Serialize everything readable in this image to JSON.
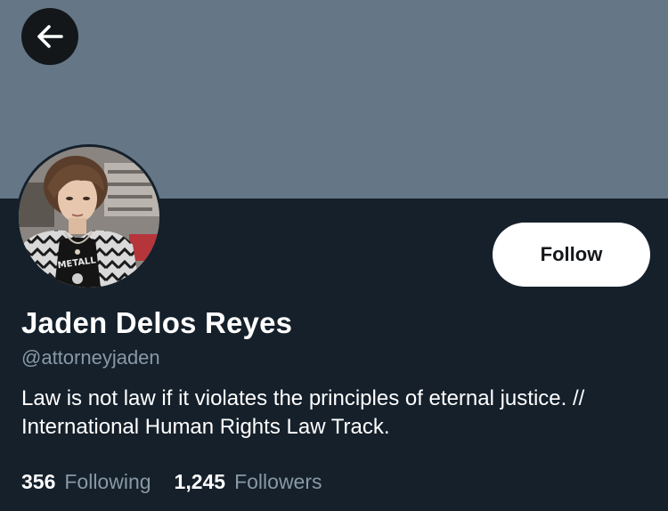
{
  "profile": {
    "display_name": "Jaden Delos Reyes",
    "handle": "@attorneyjaden",
    "bio": "Law is not law if it violates the principles of eternal justice. // International Human Rights Law Track.",
    "avatar_shirt_text": "METALL",
    "banner_color": "#657786",
    "background_color": "#15202b"
  },
  "actions": {
    "back_icon": "arrow-left-icon",
    "follow_label": "Follow"
  },
  "stats": {
    "following_count": "356",
    "following_label": "Following",
    "followers_count": "1,245",
    "followers_label": "Followers"
  }
}
